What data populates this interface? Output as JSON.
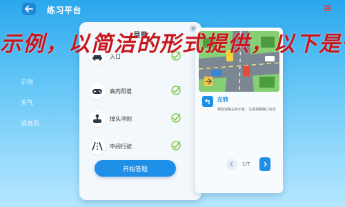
{
  "colors": {
    "accent": "#1e8fe6",
    "watermark": "#c8171c",
    "check": "#7ac943",
    "background_top": "#2aa7ee"
  },
  "topbar": {
    "title": "练习平台",
    "back_icon": "back-arrow-icon",
    "right_icon": "menu-icon"
  },
  "side_menu": {
    "items": [
      {
        "label": "示例"
      },
      {
        "label": "天气"
      },
      {
        "label": "语音风"
      }
    ]
  },
  "card": {
    "title": "目录",
    "rows": [
      {
        "label": "入口"
      },
      {
        "label": "高内阳道"
      },
      {
        "label": "掉头冲刺"
      },
      {
        "label": "中间行驶"
      }
    ],
    "start_button": "开始答题"
  },
  "right_panel": {
    "tip_title": "左转",
    "tip_desc": "模拟道路左转示意，注意观察路口标志",
    "pager_text": "1/7"
  },
  "watermark": "示例，以简洁的形式提供，以下是一"
}
